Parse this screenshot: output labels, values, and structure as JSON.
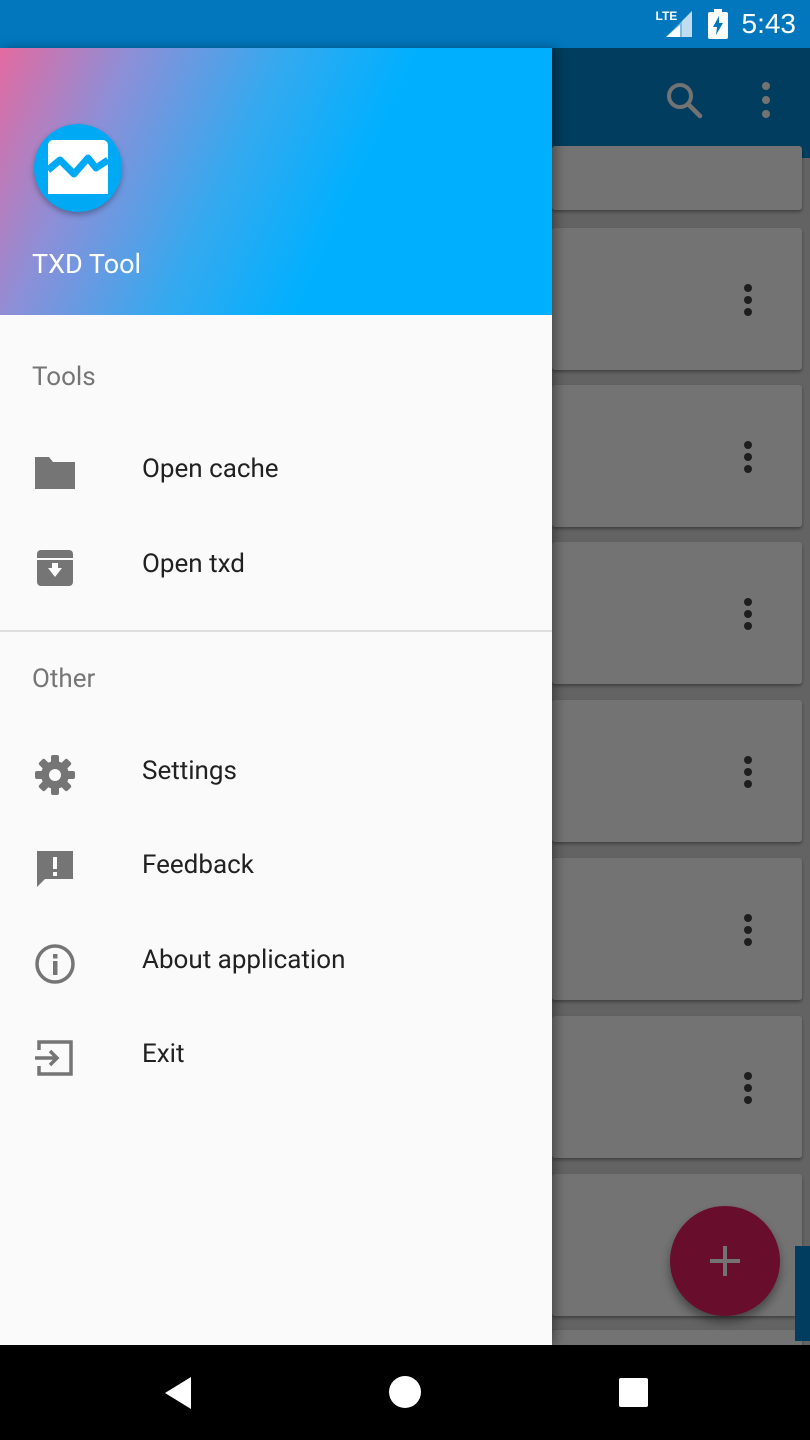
{
  "status_bar": {
    "time": "5:43",
    "network": "LTE"
  },
  "drawer": {
    "app_title": "TXD Tool",
    "sections": [
      {
        "label": "Tools",
        "items": [
          {
            "label": "Open cache",
            "icon": "folder-icon"
          },
          {
            "label": "Open txd",
            "icon": "archive-icon"
          }
        ]
      },
      {
        "label": "Other",
        "items": [
          {
            "label": "Settings",
            "icon": "gear-icon"
          },
          {
            "label": "Feedback",
            "icon": "feedback-icon"
          },
          {
            "label": "About application",
            "icon": "info-icon"
          },
          {
            "label": "Exit",
            "icon": "exit-icon"
          }
        ]
      }
    ]
  },
  "colors": {
    "primary": "#0288d1",
    "status_bar": "#0277bd",
    "header_accent": "#00b0ff",
    "fab": "#e91e63"
  }
}
